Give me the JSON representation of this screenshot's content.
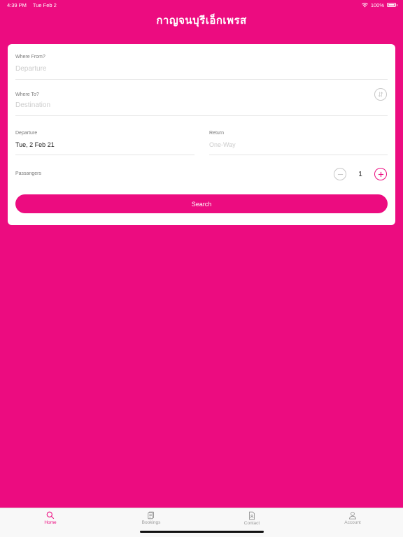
{
  "status_bar": {
    "time": "4:39 PM",
    "date": "Tue Feb 2",
    "battery": "100%"
  },
  "header": {
    "title": "กาญจนบุรีเอ็กเพรส"
  },
  "form": {
    "from": {
      "label": "Where From?",
      "placeholder": "Departure"
    },
    "to": {
      "label": "Where To?",
      "placeholder": "Destination"
    },
    "departure": {
      "label": "Departure",
      "value": "Tue, 2 Feb 21"
    },
    "return": {
      "label": "Return",
      "placeholder": "One-Way"
    },
    "passengers": {
      "label": "Passangers",
      "count": "1"
    },
    "search_label": "Search"
  },
  "tabs": [
    {
      "label": "Home",
      "icon": "search-icon",
      "active": true
    },
    {
      "label": "Bookings",
      "icon": "bookings-icon",
      "active": false
    },
    {
      "label": "Contact",
      "icon": "contact-icon",
      "active": false
    },
    {
      "label": "Account",
      "icon": "account-icon",
      "active": false
    }
  ],
  "colors": {
    "brand": "#ec0c80"
  }
}
